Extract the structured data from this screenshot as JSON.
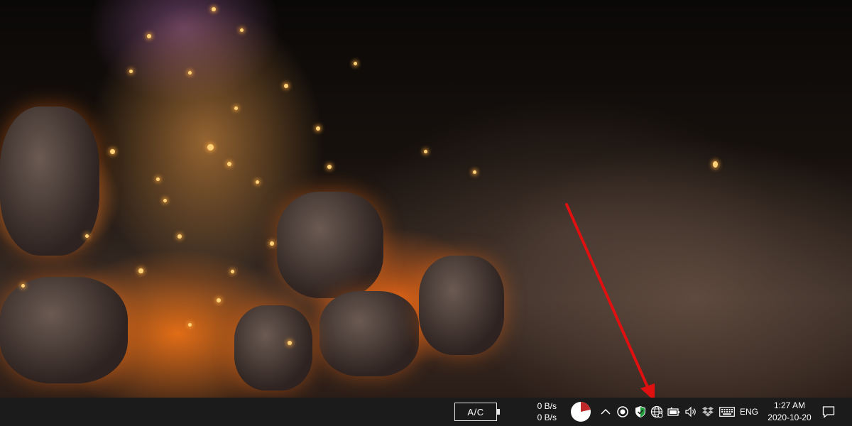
{
  "wallpaper": {
    "description_icon": "campfire-embers-wallpaper"
  },
  "taskbar": {
    "battery_widget": {
      "label": "A/C"
    },
    "network_speed": {
      "upload": "0 B/s",
      "download": "0 B/s"
    },
    "pie_indicator_icon": "pie-chart-icon",
    "tray_icons": [
      "chevron-up-icon",
      "record-icon",
      "shield-icon",
      "globe-icon",
      "battery-icon",
      "volume-icon",
      "dropbox-icon",
      "keyboard-icon"
    ],
    "language": "ENG",
    "clock": {
      "time": "1:27 AM",
      "date": "2020-10-20"
    },
    "notifications_icon": "notification-icon"
  },
  "annotation": {
    "arrow_color": "#e01010"
  }
}
